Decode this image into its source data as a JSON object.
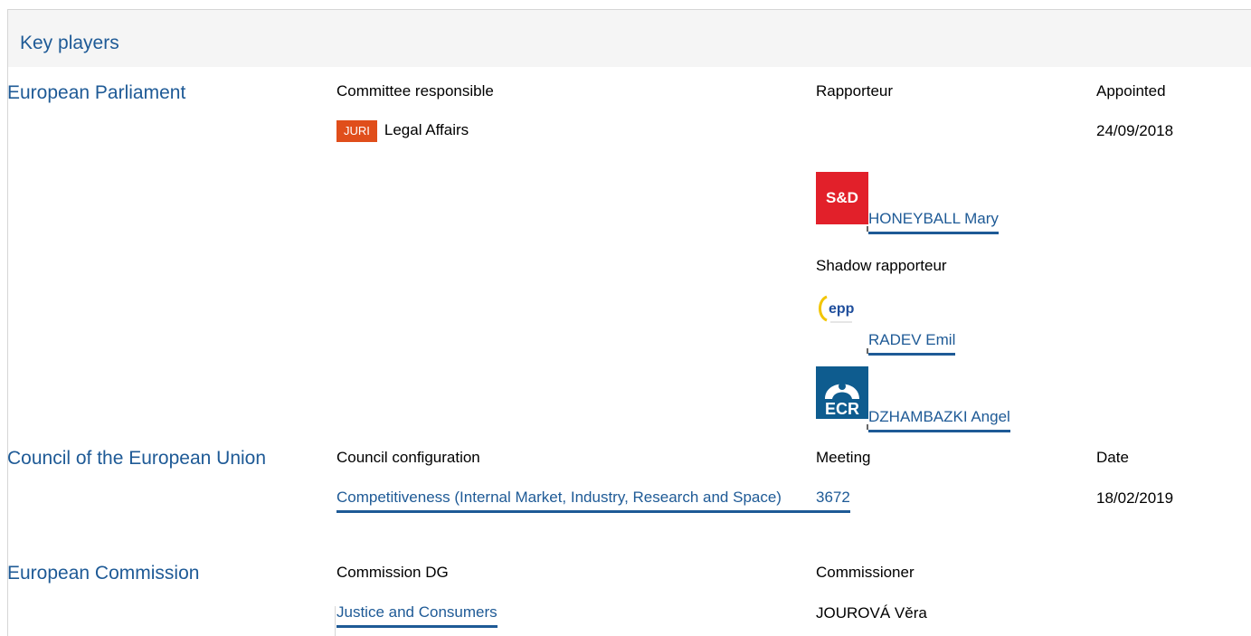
{
  "header": {
    "title": "Key players"
  },
  "ep": {
    "institution": "European Parliament",
    "col_committee": "Committee responsible",
    "col_rapporteur": "Rapporteur",
    "col_appointed": "Appointed",
    "committee_badge": "JURI",
    "committee_name": "Legal Affairs",
    "appointed_date": "24/09/2018",
    "rapporteur": {
      "name": "HONEYBALL Mary",
      "group_logo": "S&D"
    },
    "shadow_label": "Shadow rapporteur",
    "shadows": [
      {
        "name": "RADEV Emil",
        "group_logo": "epp"
      },
      {
        "name": "DZHAMBAZKI Angel",
        "group_logo": "ECR"
      }
    ]
  },
  "council": {
    "institution": "Council of the European Union",
    "col_config": "Council configuration",
    "col_meeting": "Meeting",
    "col_date": "Date",
    "config": "Competitiveness (Internal Market, Industry, Research and Space)",
    "meeting": "3672",
    "date": "18/02/2019"
  },
  "commission": {
    "institution": "European Commission",
    "col_dg": "Commission DG",
    "col_commissioner": "Commissioner",
    "dg": "Justice and Consumers",
    "commissioner": "JOUROVÁ Věra"
  },
  "colors": {
    "link": "#1e5a96",
    "juri_badge": "#e04e1b",
    "sd_red": "#e2202a",
    "ecr_blue": "#0e5c8f",
    "epp_yellow": "#f2c500",
    "epp_blue": "#1f4e9c"
  }
}
